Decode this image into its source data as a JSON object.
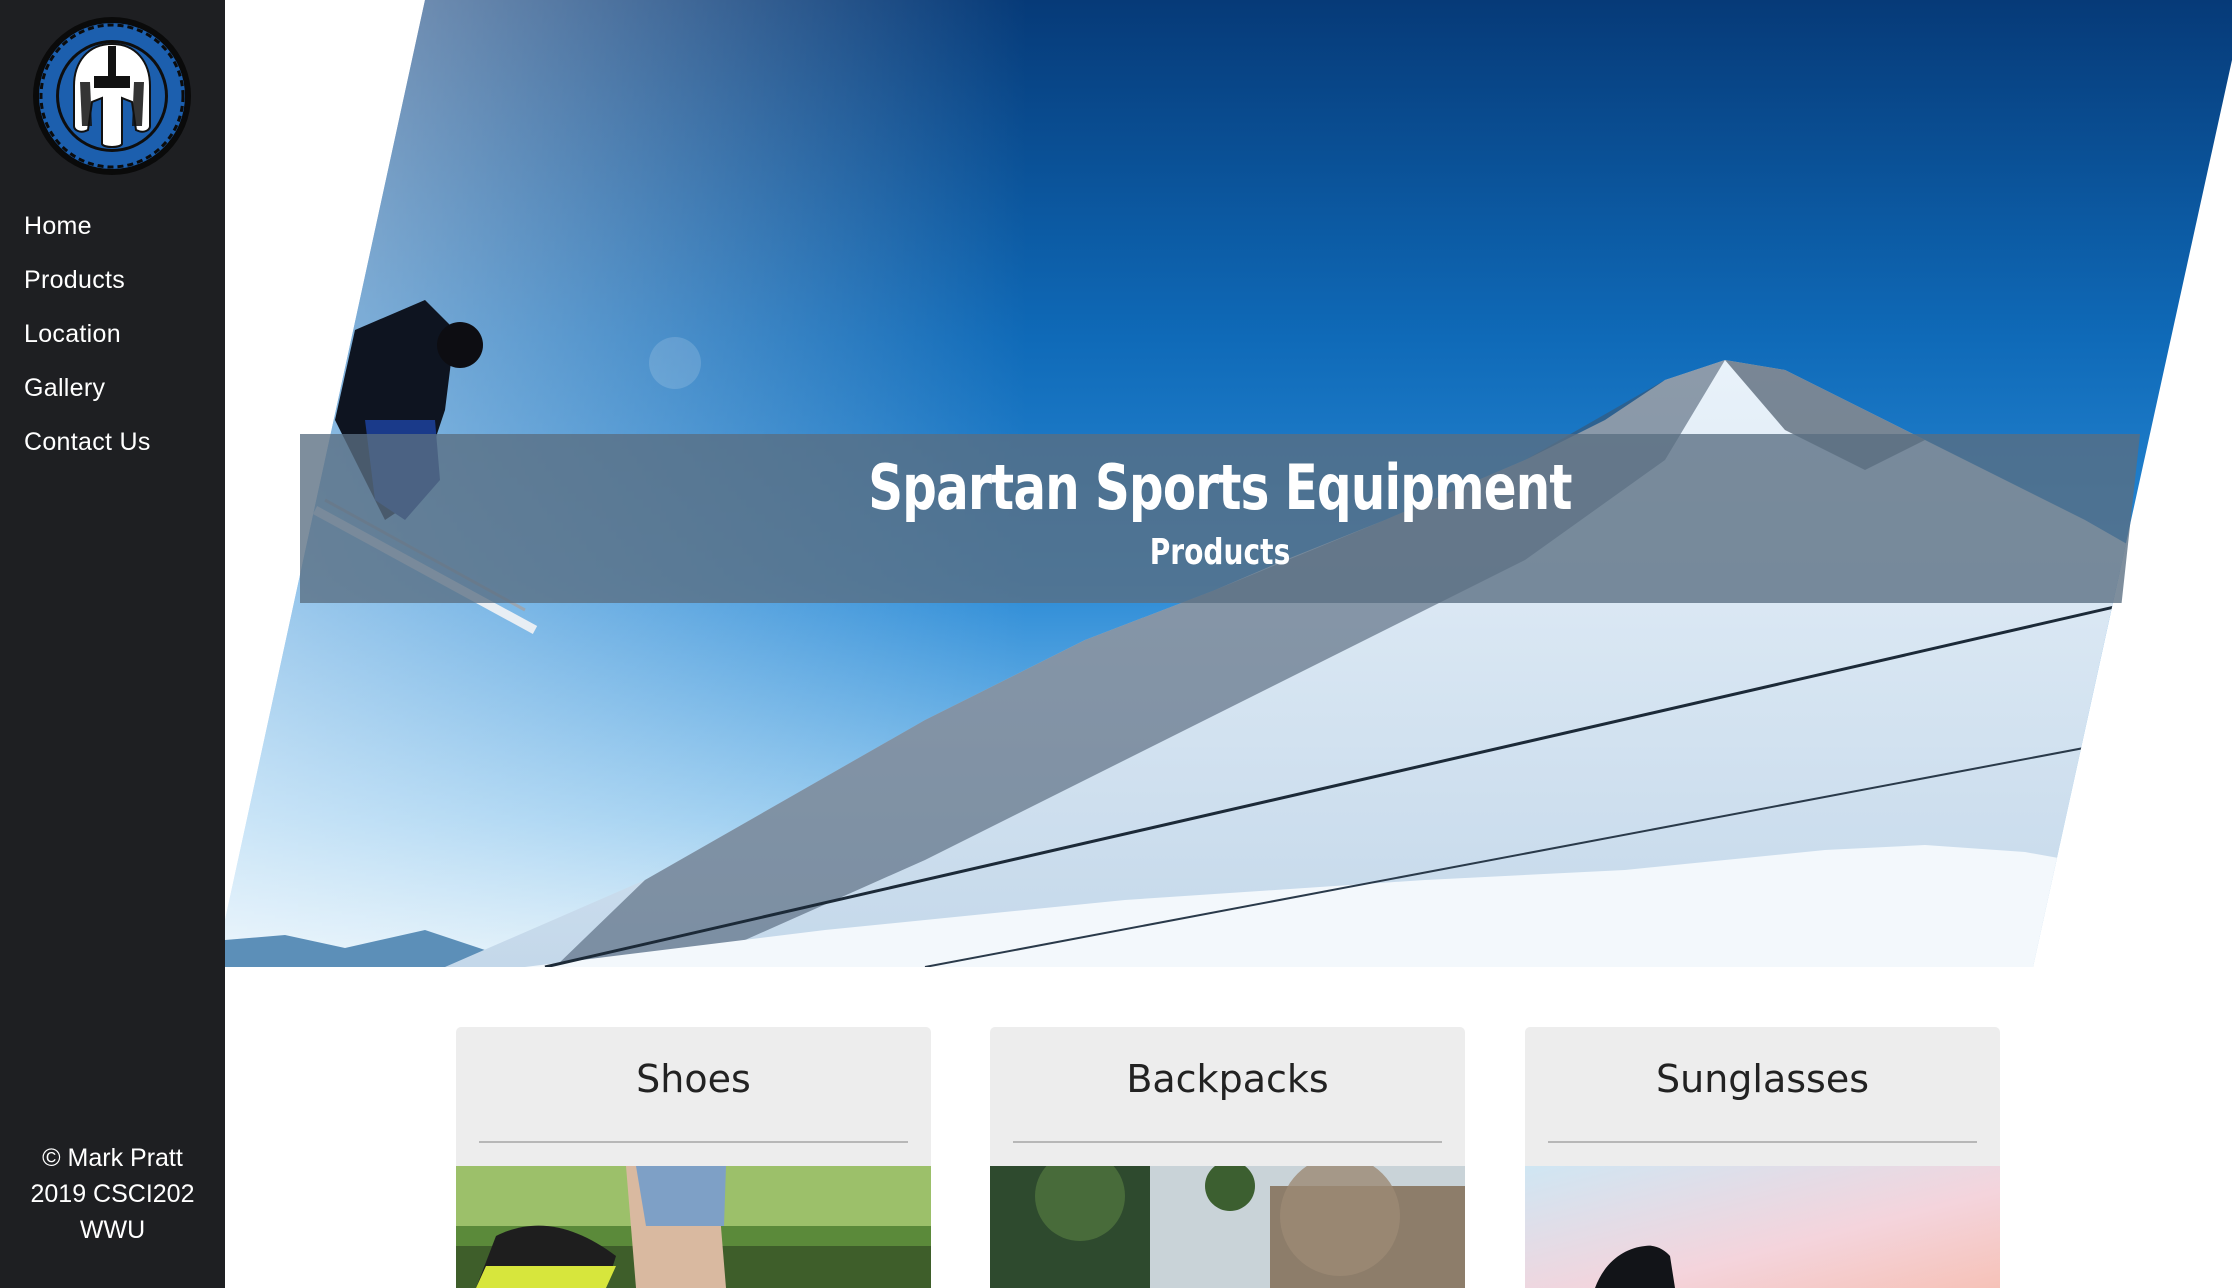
{
  "sidebar": {
    "logo": "spartan-helmet-logo",
    "nav": [
      {
        "label": "Home"
      },
      {
        "label": "Products"
      },
      {
        "label": "Location"
      },
      {
        "label": "Gallery"
      },
      {
        "label": "Contact Us"
      }
    ],
    "copyright_line1": "© Mark Pratt",
    "copyright_line2": "2019 CSCI202",
    "copyright_line3": "WWU"
  },
  "hero": {
    "title": "Spartan Sports Equipment",
    "subtitle": "Products",
    "image": "skier-mountain-photo"
  },
  "cards": [
    {
      "title": "Shoes",
      "image": "shoes-photo"
    },
    {
      "title": "Backpacks",
      "image": "backpack-trees-photo"
    },
    {
      "title": "Sunglasses",
      "image": "sunglasses-sky-photo"
    }
  ],
  "colors": {
    "sidebar_bg": "#1e1f22",
    "card_bg": "#ededed",
    "sky_top": "#063a78",
    "sky_mid": "#1b7ac8",
    "logo_blue": "#1c5fae"
  }
}
